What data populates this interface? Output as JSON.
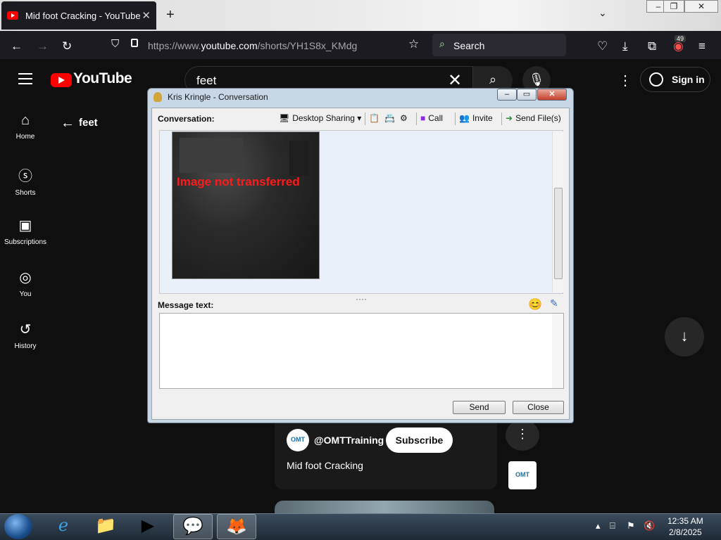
{
  "browser": {
    "tab_title": "Mid foot Cracking - YouTube",
    "url_prefix": "https://www.",
    "url_domain": "youtube.com",
    "url_path": "/shorts/YH1S8x_KMdg",
    "search_placeholder": "Search",
    "extension_badge": "49"
  },
  "youtube": {
    "logo_text": "YouTube",
    "search_value": "feet",
    "signin_label": "Sign in",
    "back_label": "feet",
    "nav": [
      {
        "label": "Home"
      },
      {
        "label": "Shorts"
      },
      {
        "label": "Subscriptions"
      },
      {
        "label": "You"
      },
      {
        "label": "History"
      }
    ],
    "short": {
      "channel": "@OMTTraining",
      "subscribe_label": "Subscribe",
      "title": "Mid foot Cracking",
      "avatar_text": "OMT"
    }
  },
  "chat": {
    "window_title": "Kris Kringle - Conversation",
    "conversation_label": "Conversation:",
    "toolbar": {
      "desktop_sharing": "Desktop Sharing",
      "call": "Call",
      "invite": "Invite",
      "send_files": "Send File(s)"
    },
    "image_error": "Image not transferred",
    "message_label": "Message text:",
    "message_value": "",
    "send_label": "Send",
    "close_label": "Close"
  },
  "taskbar": {
    "time": "12:35 AM",
    "date": "2/8/2025"
  },
  "colors": {
    "youtube_red": "#ff0000",
    "browser_dark": "#1c1b22",
    "error_red": "#ff1a1a"
  }
}
